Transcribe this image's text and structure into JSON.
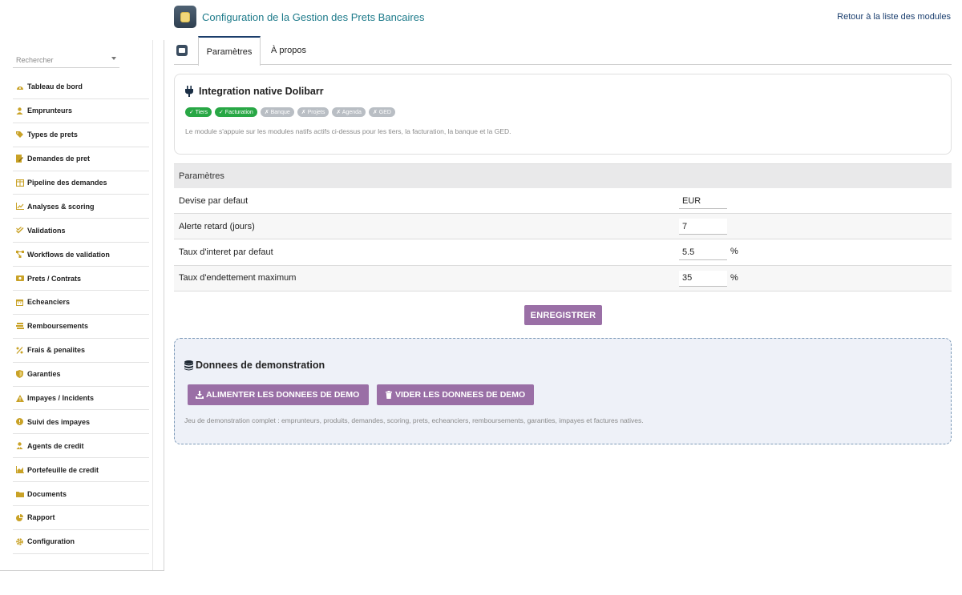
{
  "sidebar": {
    "search_placeholder": "Rechercher",
    "items": [
      {
        "label": "Tableau de bord",
        "icon": "dashboard-icon"
      },
      {
        "label": "Emprunteurs",
        "icon": "user-icon"
      },
      {
        "label": "Types de prets",
        "icon": "tags-icon"
      },
      {
        "label": "Demandes de pret",
        "icon": "file-edit-icon"
      },
      {
        "label": "Pipeline des demandes",
        "icon": "columns-icon"
      },
      {
        "label": "Analyses & scoring",
        "icon": "chart-line-icon"
      },
      {
        "label": "Validations",
        "icon": "check-double-icon"
      },
      {
        "label": "Workflows de validation",
        "icon": "flow-icon"
      },
      {
        "label": "Prets / Contrats",
        "icon": "money-bill-icon"
      },
      {
        "label": "Echeanciers",
        "icon": "calendar-icon"
      },
      {
        "label": "Remboursements",
        "icon": "stack-icon"
      },
      {
        "label": "Frais & penalites",
        "icon": "percent-icon"
      },
      {
        "label": "Garanties",
        "icon": "shield-icon"
      },
      {
        "label": "Impayes / Incidents",
        "icon": "warning-icon"
      },
      {
        "label": "Suivi des impayes",
        "icon": "exclamation-circle-icon"
      },
      {
        "label": "Agents de credit",
        "icon": "user-tie-icon"
      },
      {
        "label": "Portefeuille de credit",
        "icon": "chart-area-icon"
      },
      {
        "label": "Documents",
        "icon": "folder-icon"
      },
      {
        "label": "Rapport",
        "icon": "pie-chart-icon"
      },
      {
        "label": "Configuration",
        "icon": "gear-icon"
      }
    ],
    "icon_color": "#c9a227"
  },
  "header": {
    "title": "Configuration de la Gestion des Prets Bancaires",
    "back_link": "Retour à la liste des modules"
  },
  "tabs": {
    "active": "Paramètres",
    "about": "À propos"
  },
  "integration": {
    "title": "Integration native Dolibarr",
    "badges": [
      {
        "label": "✓ Tiers",
        "status": "active"
      },
      {
        "label": "✓ Facturation",
        "status": "active"
      },
      {
        "label": "✗ Banque",
        "status": "inactive"
      },
      {
        "label": "✗ Projets",
        "status": "inactive"
      },
      {
        "label": "✗ Agenda",
        "status": "inactive"
      },
      {
        "label": "✗ GED",
        "status": "inactive"
      }
    ],
    "note": "Le module s'appuie sur les modules natifs actifs ci-dessus pour les tiers, la facturation, la banque et la GED."
  },
  "params": {
    "header": "Paramètres",
    "rows": [
      {
        "label": "Devise par defaut",
        "value": "EUR",
        "unit": ""
      },
      {
        "label": "Alerte retard (jours)",
        "value": "7",
        "unit": ""
      },
      {
        "label": "Taux d'interet par defaut",
        "value": "5.5",
        "unit": "%"
      },
      {
        "label": "Taux d'endettement maximum",
        "value": "35",
        "unit": "%"
      }
    ],
    "save_label": "ENREGISTRER"
  },
  "demo": {
    "title": "Donnees de demonstration",
    "load_label": "ALIMENTER LES DONNEES DE DEMO",
    "clear_label": "VIDER LES DONNEES DE DEMO",
    "note": "Jeu de demonstration complet : emprunteurs, produits, demandes, scoring, prets, echeanciers, remboursements, garanties, impayes et factures natives."
  },
  "colors": {
    "title": "#1d7a8a",
    "button": "#9a6fa6",
    "badge_active": "#28a745",
    "badge_inactive": "#b9bec4"
  }
}
